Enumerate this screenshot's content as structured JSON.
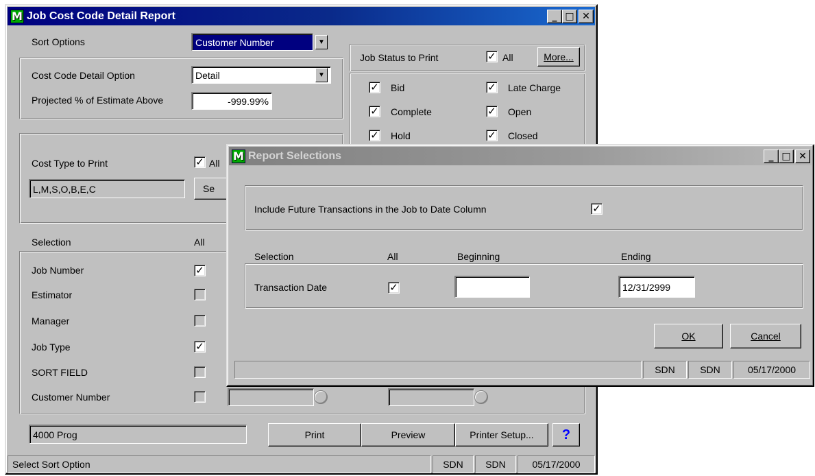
{
  "main": {
    "title": "Job Cost Code Detail Report",
    "sort_options_label": "Sort Options",
    "sort_options_value": "Customer Number",
    "cost_code_detail_label": "Cost Code Detail Option",
    "cost_code_detail_value": "Detail",
    "projected_label": "Projected % of Estimate Above",
    "projected_value": "-999.99%",
    "job_status_label": "Job Status to Print",
    "job_status_all_label": "All",
    "more_button": "More...",
    "statuses": [
      "Bid",
      "Late Charge",
      "Complete",
      "Open",
      "Hold",
      "Closed"
    ],
    "cost_type_label": "Cost Type to Print",
    "cost_type_all_label": "All",
    "cost_type_value": "L,M,S,O,B,E,C",
    "cost_type_button": "Se",
    "selection_header": "Selection",
    "all_header": "All",
    "selection_rows": [
      {
        "label": "Job Number",
        "checked": true
      },
      {
        "label": "Estimator",
        "checked": false
      },
      {
        "label": "Manager",
        "checked": false
      },
      {
        "label": "Job Type",
        "checked": true
      },
      {
        "label": "SORT FIELD",
        "checked": false
      },
      {
        "label": "Customer Number",
        "checked": false
      }
    ],
    "company": "4000 Prog",
    "print_button": "Print",
    "preview_button": "Preview",
    "printer_setup_button": "Printer Setup...",
    "help_button": "?",
    "status_text": "Select Sort Option",
    "status_user1": "SDN",
    "status_user2": "SDN",
    "status_date": "05/17/2000"
  },
  "dialog": {
    "title": "Report Selections",
    "include_future_label": "Include Future Transactions in the Job to Date Column",
    "include_future_checked": true,
    "selection_header": "Selection",
    "all_header": "All",
    "beginning_header": "Beginning",
    "ending_header": "Ending",
    "transaction_date_label": "Transaction Date",
    "transaction_date_all": true,
    "beginning_value": "",
    "ending_value": "12/31/2999",
    "ok_button": "OK",
    "cancel_button": "Cancel",
    "status_text": "",
    "status_user1": "SDN",
    "status_user2": "SDN",
    "status_date": "05/17/2000"
  },
  "icons": {
    "app_icon": "app-logo-icon",
    "minimize": "minimize-icon",
    "maximize": "maximize-icon",
    "close": "close-icon",
    "dropdown": "chevron-down-icon",
    "lookup": "lookup-icon",
    "check": "checkmark-icon"
  },
  "colors": {
    "active_title": "#000080",
    "inactive_title": "#808080",
    "face": "#c0c0c0",
    "help_icon": "#0000ff"
  }
}
